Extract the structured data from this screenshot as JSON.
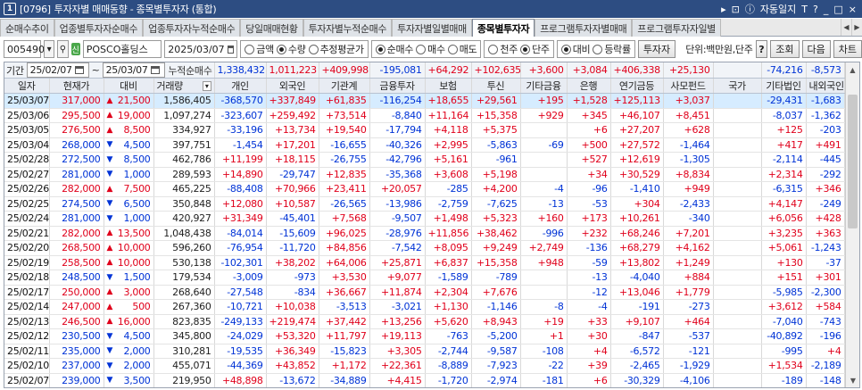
{
  "window": {
    "code": "[0796]",
    "title": "투자자별 매매동향 - 종목별투자자 (통합)",
    "auto_label": "자동일지",
    "controls": [
      "▸",
      "⊡",
      "ⓘ",
      "T",
      "?",
      "_",
      "□",
      "×"
    ],
    "num_badge": "1"
  },
  "tabs": [
    "순매수추이",
    "업종별투자자순매수",
    "업종투자자누적순매수",
    "당일매매현황",
    "투자자별누적순매수",
    "투자자별일별매매",
    "종목별투자자",
    "프로그램투자자별매매",
    "프로그램투자자일별"
  ],
  "active_tab": 6,
  "toolbar": {
    "stock_code": "005490",
    "stock_name": "POSCO홀딩스",
    "date": "2025/03/07",
    "amount_opts": [
      "금액",
      "수량",
      "추정평균가"
    ],
    "amount_sel": 1,
    "trade_opts": [
      "순매수",
      "매수",
      "매도"
    ],
    "trade_sel": 0,
    "unit_opts": [
      "천주",
      "단주"
    ],
    "unit_sel": 1,
    "cmp_opts": [
      "대비",
      "등락률"
    ],
    "cmp_sel": 0,
    "investor_btn": "투자자",
    "unit_label": "단위:백만원,단주",
    "help_btn": "?",
    "query_btn": "조회",
    "next_btn": "다음",
    "chart_btn": "차트"
  },
  "period": {
    "label": "기간",
    "from": "25/02/07",
    "to": "25/03/07",
    "cum_label": "누적순매수"
  },
  "summary": [
    "1,338,432",
    "1,011,223",
    "+409,998",
    "-195,081",
    "+64,292",
    "+102,635",
    "+3,600",
    "+3,084",
    "+406,338",
    "+25,130",
    "",
    "-74,216",
    "-8,573"
  ],
  "columns": [
    "일자",
    "현재가",
    "대비",
    "거래량",
    "개인",
    "외국인",
    "기관계",
    "금융투자",
    "보험",
    "투신",
    "기타금융",
    "은행",
    "연기금등",
    "사모펀드",
    "국가",
    "기타법인",
    "내외국인"
  ],
  "rows": [
    [
      "25/03/07",
      "317,000",
      "up",
      "21,500",
      "1,586,405",
      "-368,570",
      "+337,849",
      "+61,835",
      "-116,254",
      "+18,655",
      "+29,561",
      "+195",
      "+1,528",
      "+125,113",
      "+3,037",
      "",
      "-29,431",
      "-1,683"
    ],
    [
      "25/03/06",
      "295,500",
      "up",
      "19,000",
      "1,097,274",
      "-323,607",
      "+259,492",
      "+73,514",
      "-8,840",
      "+11,164",
      "+15,358",
      "+929",
      "+345",
      "+46,107",
      "+8,451",
      "",
      "-8,037",
      "-1,362"
    ],
    [
      "25/03/05",
      "276,500",
      "up",
      "8,500",
      "334,927",
      "-33,196",
      "+13,734",
      "+19,540",
      "-17,794",
      "+4,118",
      "+5,375",
      "",
      "+6",
      "+27,207",
      "+628",
      "",
      "+125",
      "-203"
    ],
    [
      "25/03/04",
      "268,000",
      "dn",
      "4,500",
      "397,751",
      "-1,454",
      "+17,201",
      "-16,655",
      "-40,326",
      "+2,995",
      "-5,863",
      "-69",
      "+500",
      "+27,572",
      "-1,464",
      "",
      "+417",
      "+491"
    ],
    [
      "25/02/28",
      "272,500",
      "dn",
      "8,500",
      "462,786",
      "+11,199",
      "+18,115",
      "-26,755",
      "-42,796",
      "+5,161",
      "-961",
      "",
      "+527",
      "+12,619",
      "-1,305",
      "",
      "-2,114",
      "-445"
    ],
    [
      "25/02/27",
      "281,000",
      "dn",
      "1,000",
      "289,593",
      "+14,890",
      "-29,747",
      "+12,835",
      "-35,368",
      "+3,608",
      "+5,198",
      "",
      "+34",
      "+30,529",
      "+8,834",
      "",
      "+2,314",
      "-292"
    ],
    [
      "25/02/26",
      "282,000",
      "up",
      "7,500",
      "465,225",
      "-88,408",
      "+70,966",
      "+23,411",
      "+20,057",
      "-285",
      "+4,200",
      "-4",
      "-96",
      "-1,410",
      "+949",
      "",
      "-6,315",
      "+346"
    ],
    [
      "25/02/25",
      "274,500",
      "dn",
      "6,500",
      "350,848",
      "+12,080",
      "+10,587",
      "-26,565",
      "-13,986",
      "-2,759",
      "-7,625",
      "-13",
      "-53",
      "+304",
      "-2,433",
      "",
      "+4,147",
      "-249"
    ],
    [
      "25/02/24",
      "281,000",
      "dn",
      "1,000",
      "420,927",
      "+31,349",
      "-45,401",
      "+7,568",
      "-9,507",
      "+1,498",
      "+5,323",
      "+160",
      "+173",
      "+10,261",
      "-340",
      "",
      "+6,056",
      "+428"
    ],
    [
      "25/02/21",
      "282,000",
      "up",
      "13,500",
      "1,048,438",
      "-84,014",
      "-15,609",
      "+96,025",
      "-28,976",
      "+11,856",
      "+38,462",
      "-996",
      "+232",
      "+68,246",
      "+7,201",
      "",
      "+3,235",
      "+363"
    ],
    [
      "25/02/20",
      "268,500",
      "up",
      "10,000",
      "596,260",
      "-76,954",
      "-11,720",
      "+84,856",
      "-7,542",
      "+8,095",
      "+9,249",
      "+2,749",
      "-136",
      "+68,279",
      "+4,162",
      "",
      "+5,061",
      "-1,243"
    ],
    [
      "25/02/19",
      "258,500",
      "up",
      "10,000",
      "530,138",
      "-102,301",
      "+38,202",
      "+64,006",
      "+25,871",
      "+6,837",
      "+15,358",
      "+948",
      "-59",
      "+13,802",
      "+1,249",
      "",
      "+130",
      "-37"
    ],
    [
      "25/02/18",
      "248,500",
      "dn",
      "1,500",
      "179,534",
      "-3,009",
      "-973",
      "+3,530",
      "+9,077",
      "-1,589",
      "-789",
      "",
      "-13",
      "-4,040",
      "+884",
      "",
      "+151",
      "+301"
    ],
    [
      "25/02/17",
      "250,000",
      "up",
      "3,000",
      "268,640",
      "-27,548",
      "-834",
      "+36,667",
      "+11,874",
      "+2,304",
      "+7,676",
      "",
      "-12",
      "+13,046",
      "+1,779",
      "",
      "-5,985",
      "-2,300"
    ],
    [
      "25/02/14",
      "247,000",
      "up",
      "500",
      "267,360",
      "-10,721",
      "+10,038",
      "-3,513",
      "-3,021",
      "+1,130",
      "-1,146",
      "-8",
      "-4",
      "-191",
      "-273",
      "",
      "+3,612",
      "+584"
    ],
    [
      "25/02/13",
      "246,500",
      "up",
      "16,000",
      "823,835",
      "-249,133",
      "+219,474",
      "+37,442",
      "+13,256",
      "+5,620",
      "+8,943",
      "+19",
      "+33",
      "+9,107",
      "+464",
      "",
      "-7,040",
      "-743"
    ],
    [
      "25/02/12",
      "230,500",
      "dn",
      "4,500",
      "345,800",
      "-24,029",
      "+53,320",
      "+11,797",
      "+19,113",
      "-763",
      "-5,200",
      "+1",
      "+30",
      "-847",
      "-537",
      "",
      "-40,892",
      "-196"
    ],
    [
      "25/02/11",
      "235,000",
      "dn",
      "2,000",
      "310,281",
      "-19,535",
      "+36,349",
      "-15,823",
      "+3,305",
      "-2,744",
      "-9,587",
      "-108",
      "+4",
      "-6,572",
      "-121",
      "",
      "-995",
      "+4"
    ],
    [
      "25/02/10",
      "237,000",
      "dn",
      "2,000",
      "455,071",
      "-44,369",
      "+43,852",
      "+1,172",
      "+22,361",
      "-8,889",
      "-7,923",
      "-22",
      "+39",
      "-2,465",
      "-1,929",
      "",
      "+1,534",
      "-2,189"
    ],
    [
      "25/02/07",
      "239,000",
      "dn",
      "3,500",
      "219,950",
      "+48,898",
      "-13,672",
      "-34,889",
      "+4,415",
      "-1,720",
      "-2,974",
      "-181",
      "+6",
      "-30,329",
      "-4,106",
      "",
      "-189",
      "-148"
    ]
  ],
  "colors": {
    "up": "#e0001b",
    "down": "#0033d6",
    "title_bg": "#2d4d82"
  }
}
